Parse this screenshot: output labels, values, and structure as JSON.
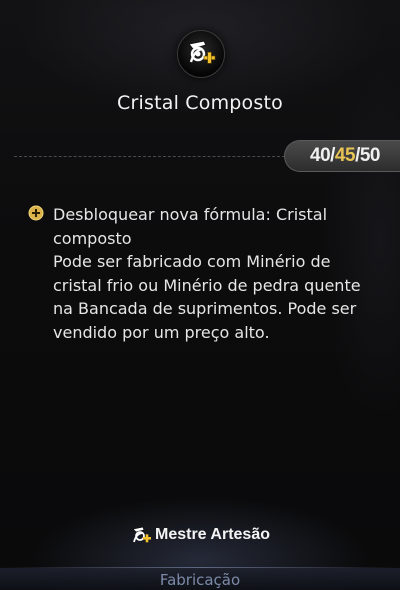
{
  "header": {
    "icon": "artisan-crafting-icon",
    "title": "Cristal Composto"
  },
  "progress": {
    "first": "40",
    "sep1": "/",
    "second": "45",
    "sep2": "/",
    "third": "50"
  },
  "reward": {
    "icon": "plus-circle-icon",
    "text": "Desbloquear nova fórmula: Cristal\ncomposto\nPode ser fabricado com Minério de\ncristal frio ou Minério de pedra quente\nna Bancada de suprimentos. Pode ser\nvendido por um preço alto."
  },
  "footer": {
    "badge_icon": "artisan-crafting-icon",
    "badge_label": "Mestre Artesão",
    "tab_label": "Fabricação"
  },
  "colors": {
    "accent_gold": "#e8c455",
    "tab_text": "#7c8aa8"
  }
}
